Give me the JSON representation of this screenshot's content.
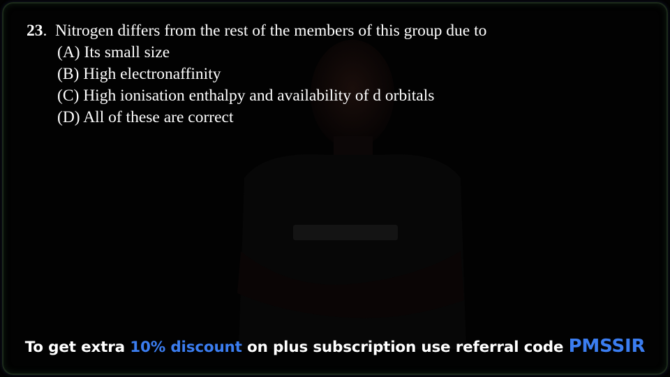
{
  "question": {
    "number": "23",
    "text": "Nitrogen differs from the rest of the members of this group due to",
    "options": [
      "(A) Its small size",
      "(B) High electronaffinity",
      "(C) High ionisation enthalpy and availability of d orbitals",
      "(D) All of these are correct"
    ]
  },
  "promo": {
    "prefix": "To get extra ",
    "discount": "10% discount",
    "middle": " on plus subscription use referral code ",
    "code": "PMSSIR"
  },
  "colors": {
    "background": "#020202",
    "text": "#ffffff",
    "accent": "#3b7df0"
  }
}
